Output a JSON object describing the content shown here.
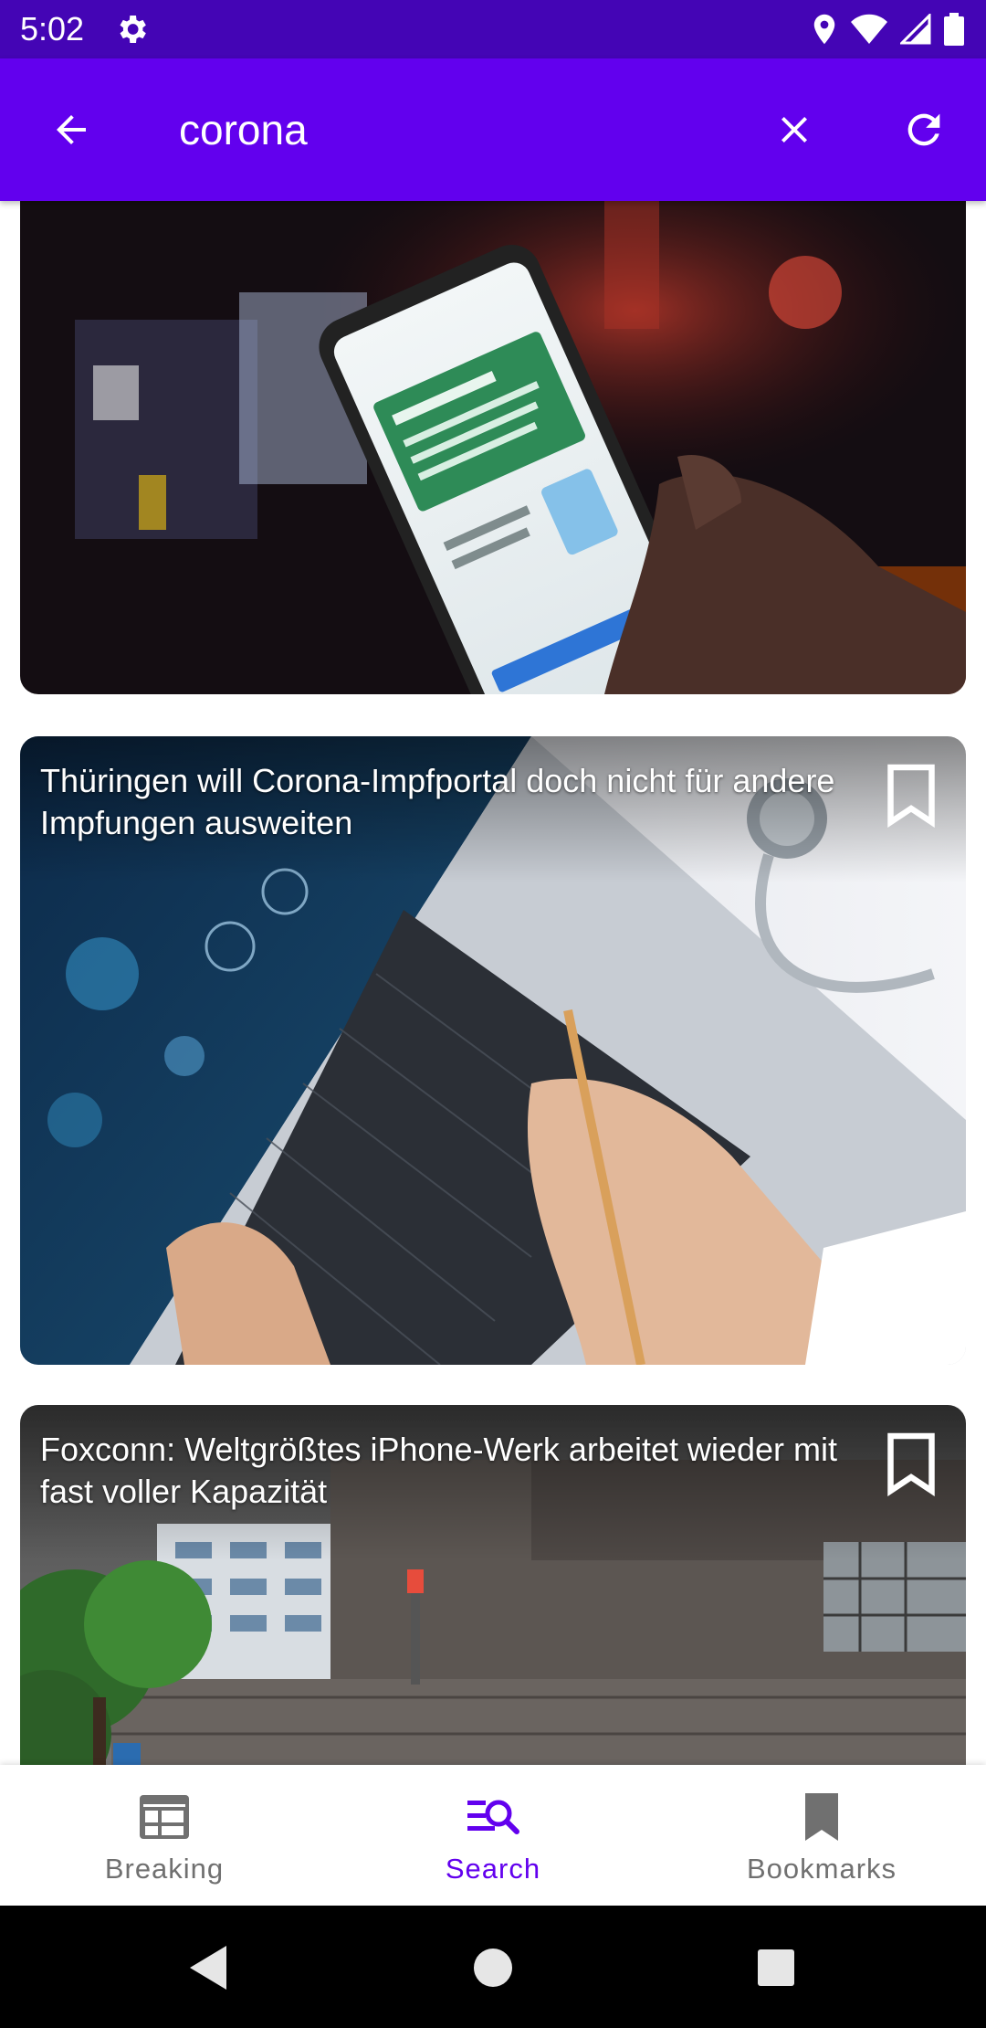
{
  "status_bar": {
    "time": "5:02"
  },
  "search": {
    "query": "corona"
  },
  "articles": [
    {
      "title": "Thüringen will Corona-Impfportal doch nicht für andere Impfungen ausweiten"
    },
    {
      "title": "Foxconn: Weltgrößtes iPhone-Werk arbeitet wieder mit fast voller Kapazität"
    }
  ],
  "bottom_nav": {
    "items": [
      {
        "label": "Breaking",
        "icon": "newspaper-icon"
      },
      {
        "label": "Search",
        "icon": "search-list-icon",
        "active": true
      },
      {
        "label": "Bookmarks",
        "icon": "bookmark-icon"
      }
    ]
  },
  "colors": {
    "primary": "#6200EE",
    "status_bar": "#4405B5",
    "nav_inactive": "#707070"
  }
}
